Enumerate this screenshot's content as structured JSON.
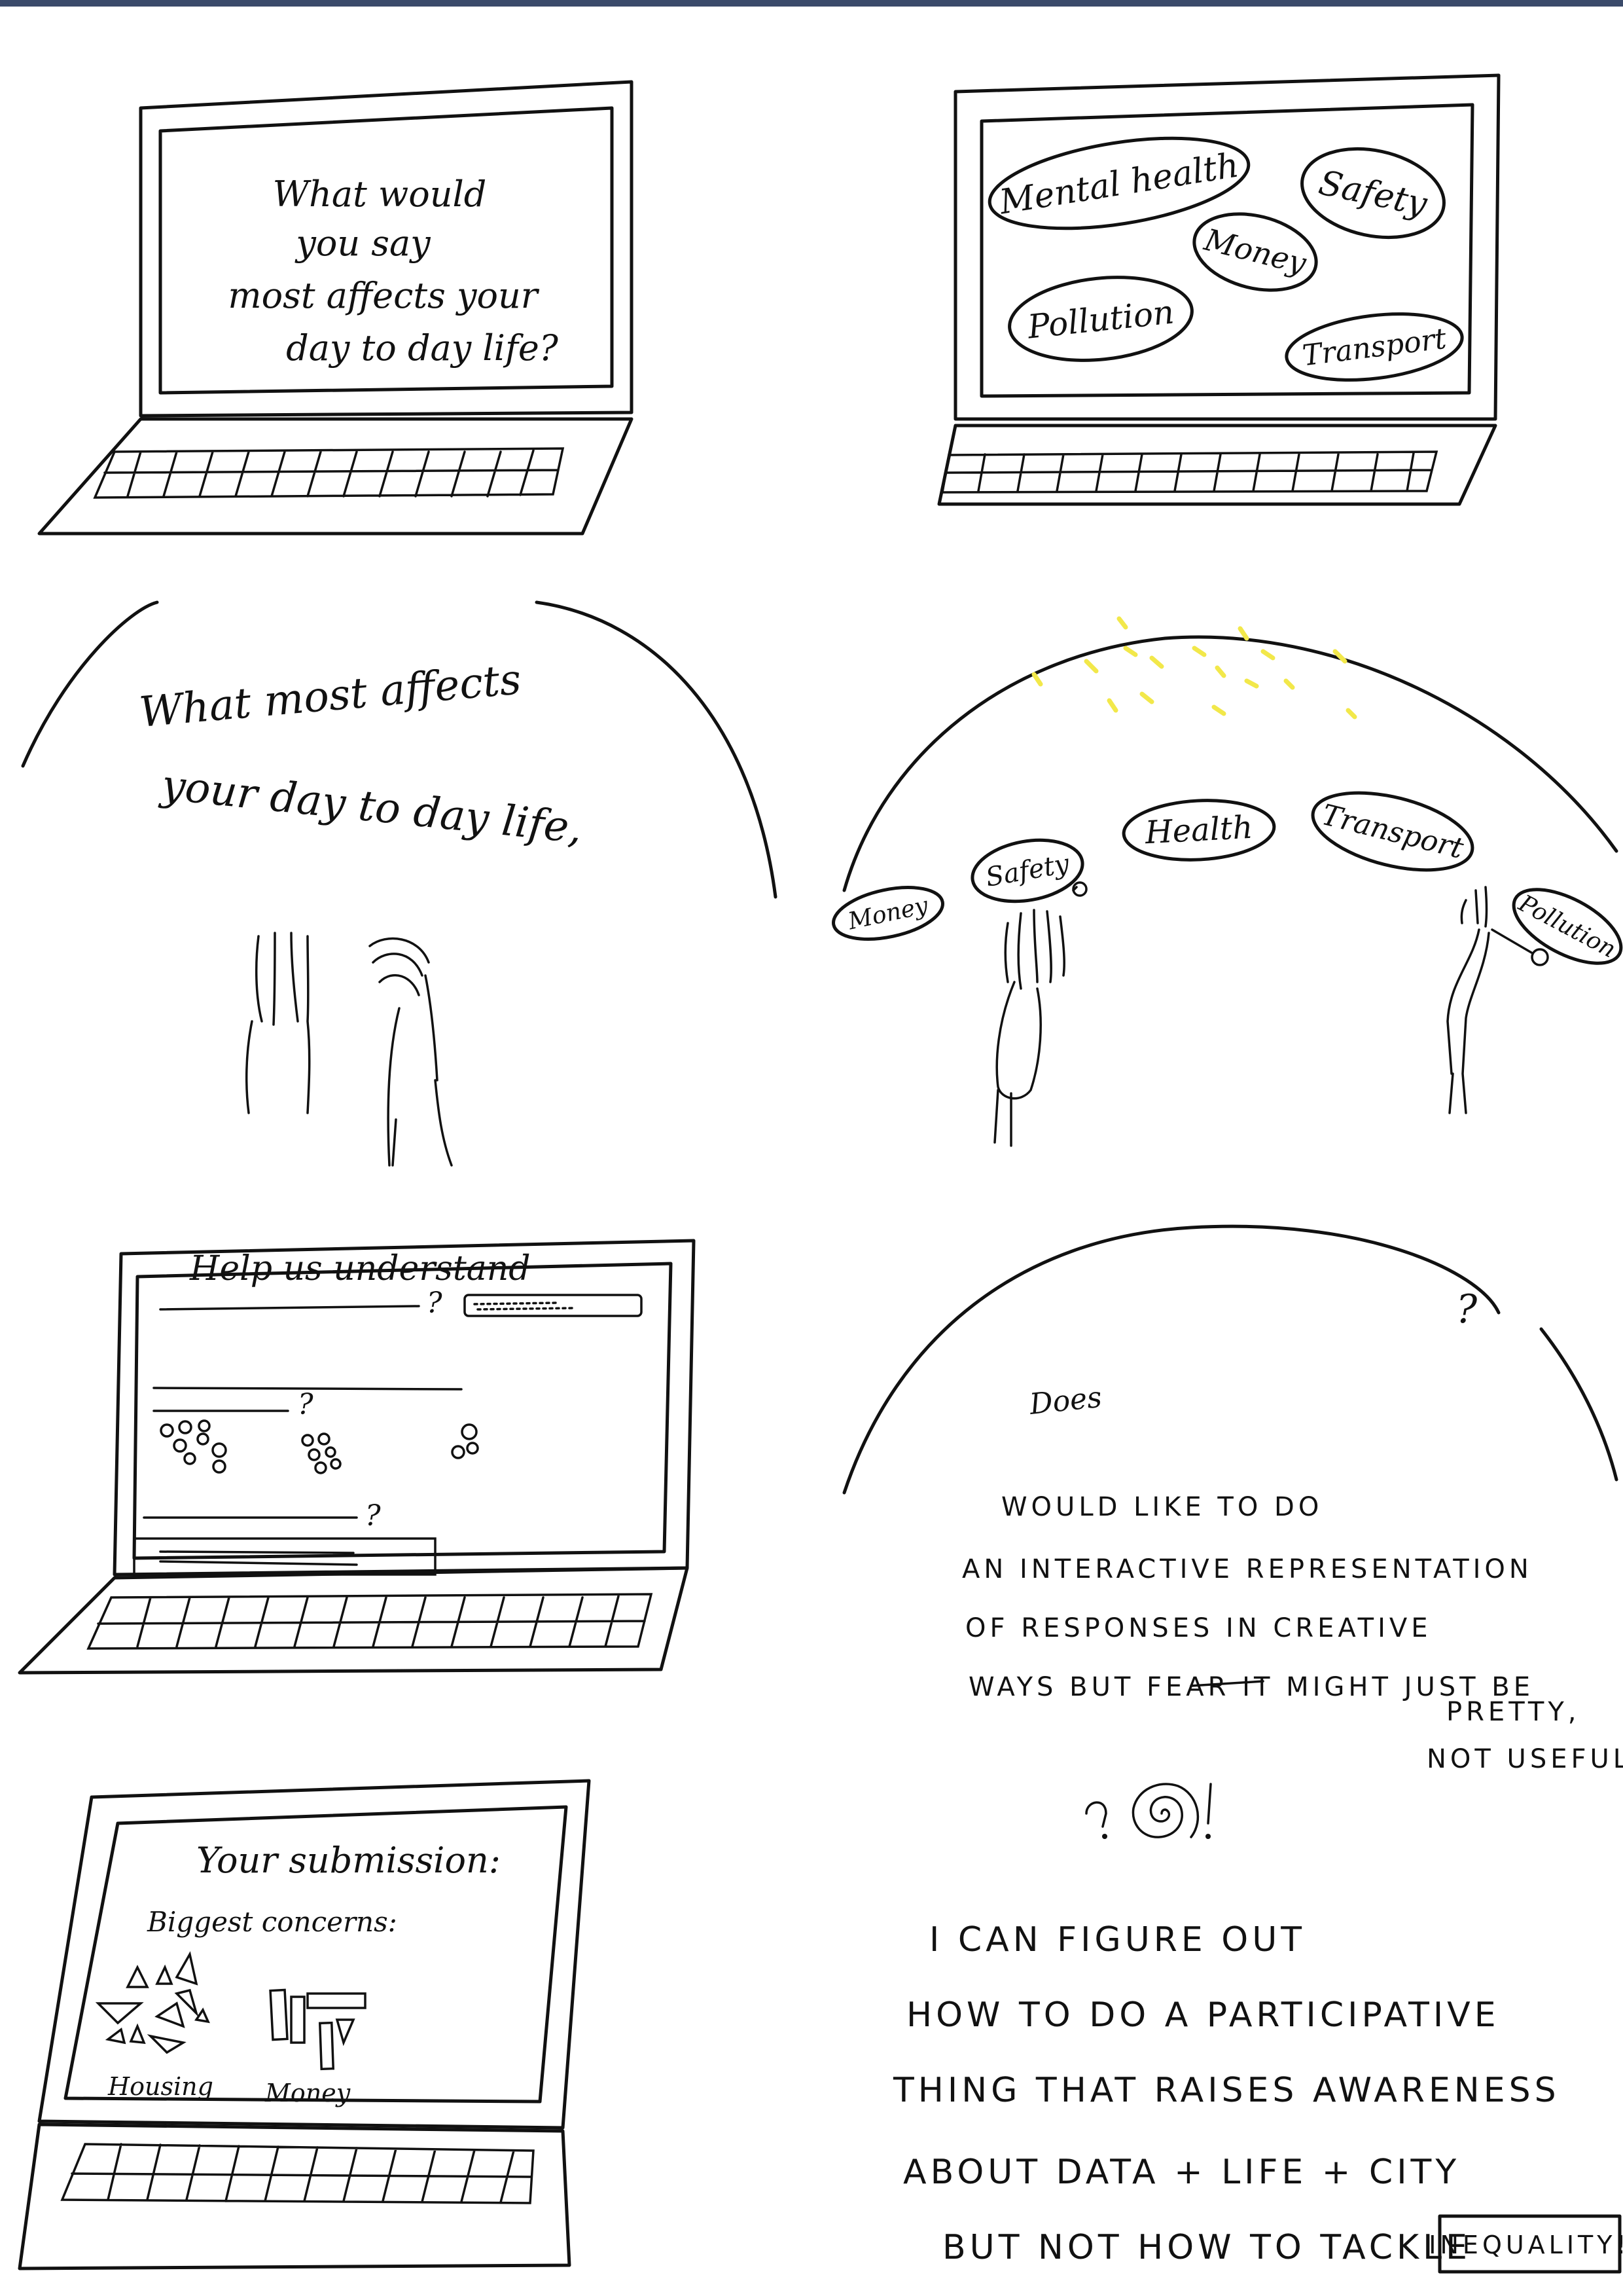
{
  "panel1": {
    "question_lines": [
      "What would",
      "you say",
      "most affects your",
      "day to day life?"
    ]
  },
  "panel2": {
    "bubbles": [
      "Mental health",
      "Safety",
      "Money",
      "Pollution",
      "Transport"
    ]
  },
  "panel3": {
    "question_lines": [
      "What most affects",
      "your day to day life,"
    ]
  },
  "panel4": {
    "bubbles": [
      "Money",
      "Safety",
      "Health",
      "Transport",
      "Pollution"
    ]
  },
  "panel5": {
    "title": "Help us understand",
    "question_marks": [
      "?",
      "?",
      "?"
    ]
  },
  "panel6": {
    "question_mark": "?",
    "word": "Does"
  },
  "panel7": {
    "title": "Your submission:",
    "subtitle": "Biggest concerns:",
    "labels": [
      "Housing",
      "Money"
    ]
  },
  "notes": {
    "top_lines": [
      "WOULD  LIKE  TO  DO",
      "AN  INTERACTIVE  REPRESENTATION",
      "OF  RESPONSES  IN  CREATIVE",
      "WAYS  BUT  FEAR  IT  MIGHT  JUST  BE",
      "PRETTY,",
      "NOT  USEFUL."
    ],
    "doodle": "?.@!",
    "bottom_lines": [
      "I  CAN  FIGURE  OUT",
      "HOW  TO  DO  A  PARTICIPATIVE",
      "THING  THAT  RAISES  AWARENESS",
      "ABOUT  DATA + LIFE + CITY",
      "BUT  NOT  HOW  TO  TACKLE"
    ],
    "boxed_word": "INEQUALITY!"
  }
}
